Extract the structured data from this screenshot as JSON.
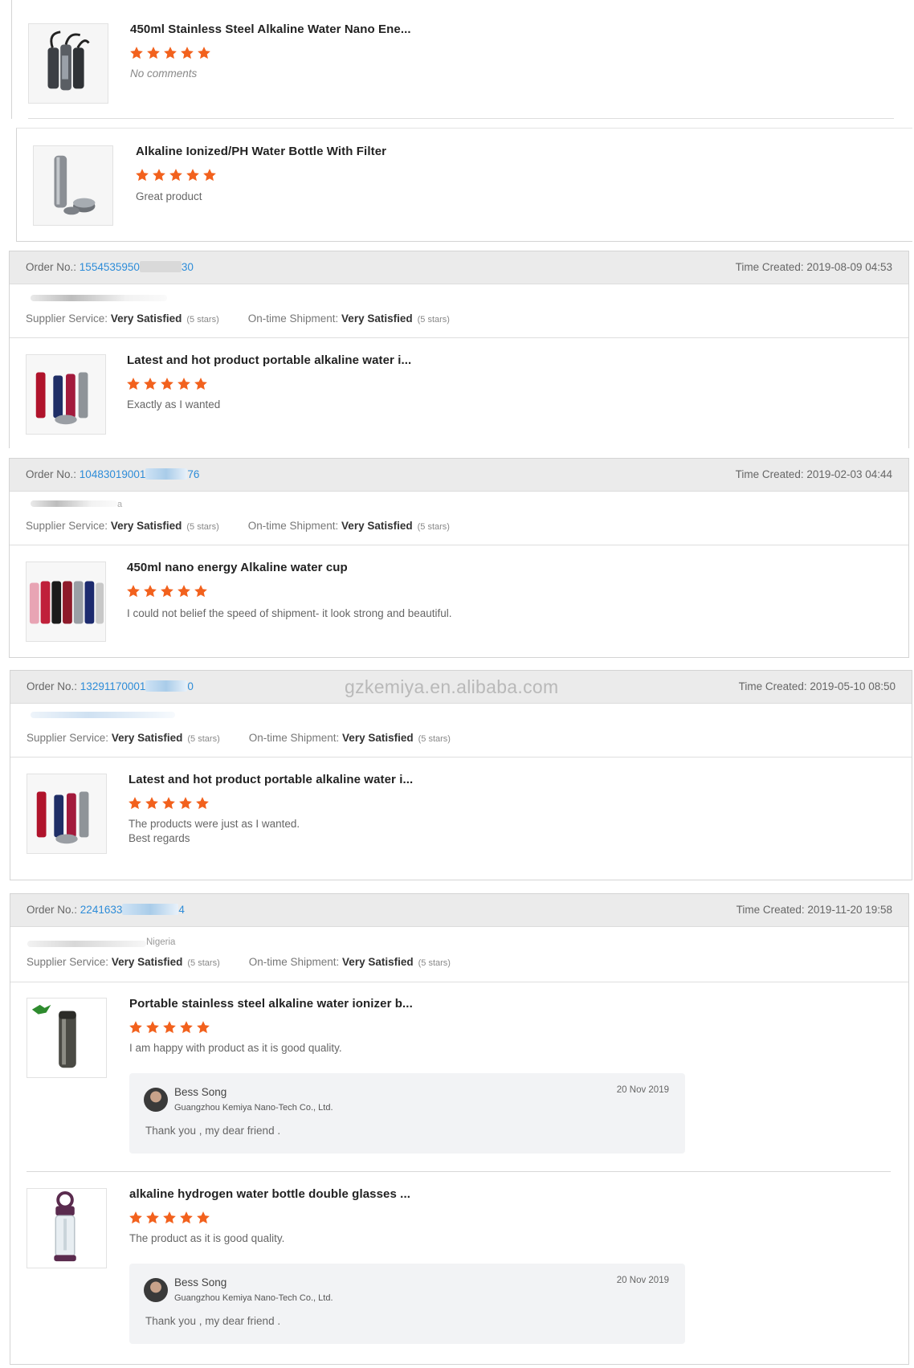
{
  "watermark": "gzkemiya.en.alibaba.com",
  "labels": {
    "order_no": "Order No.:",
    "time_created": "Time Created:",
    "supplier_service": "Supplier Service:",
    "ontime_shipment": "On-time Shipment:",
    "very_satisfied": "Very Satisfied",
    "five_stars": "(5 stars)"
  },
  "colors": {
    "star": "#f2611d",
    "order_link": "#2d8cd8",
    "bar_bg": "#ebebeb"
  },
  "top_products": [
    {
      "title": "450ml Stainless Steel Alkaline Water Nano Ene...",
      "rating": 5,
      "comment": "No comments"
    },
    {
      "title": "Alkaline Ionized/PH Water Bottle With Filter",
      "rating": 5,
      "comment": "Great product"
    }
  ],
  "orders": [
    {
      "order_no": "1554535950",
      "order_no_tail": "30",
      "time": "2019-08-09 04:53",
      "buyer_tail": "",
      "product": {
        "title": "Latest and hot product portable alkaline water i...",
        "rating": 5,
        "comment": "Exactly as I wanted"
      }
    },
    {
      "order_no": "10483019001",
      "order_no_tail": "76",
      "time": "2019-02-03 04:44",
      "buyer_tail": "a",
      "product": {
        "title": "450ml nano energy Alkaline water cup",
        "rating": 5,
        "comment": "I could not belief the speed of shipment- it look strong and beautiful."
      }
    },
    {
      "order_no": "13291170001",
      "order_no_tail": "0",
      "time": "2019-05-10 08:50",
      "buyer_tail": "",
      "product": {
        "title": "Latest and hot product portable alkaline water i...",
        "rating": 5,
        "comment_line1": "The products were just as I wanted.",
        "comment_line2": "Best regards"
      }
    },
    {
      "order_no": "2241633",
      "order_no_tail": "4",
      "time": "2019-11-20 19:58",
      "buyer_tail": "Nigeria",
      "products": [
        {
          "title": "Portable stainless steel alkaline water ionizer b...",
          "rating": 5,
          "comment": "I am happy with product as it is good quality.",
          "reply": {
            "name": "Bess Song",
            "company": "Guangzhou Kemiya Nano-Tech Co., Ltd.",
            "date": "20 Nov 2019",
            "message": "Thank you , my dear friend ."
          }
        },
        {
          "title": "alkaline hydrogen water bottle double glasses ...",
          "rating": 5,
          "comment": "The product as it is good quality.",
          "reply": {
            "name": "Bess Song",
            "company": "Guangzhou Kemiya Nano-Tech Co., Ltd.",
            "date": "20 Nov 2019",
            "message": "Thank you , my dear friend ."
          }
        }
      ]
    }
  ]
}
